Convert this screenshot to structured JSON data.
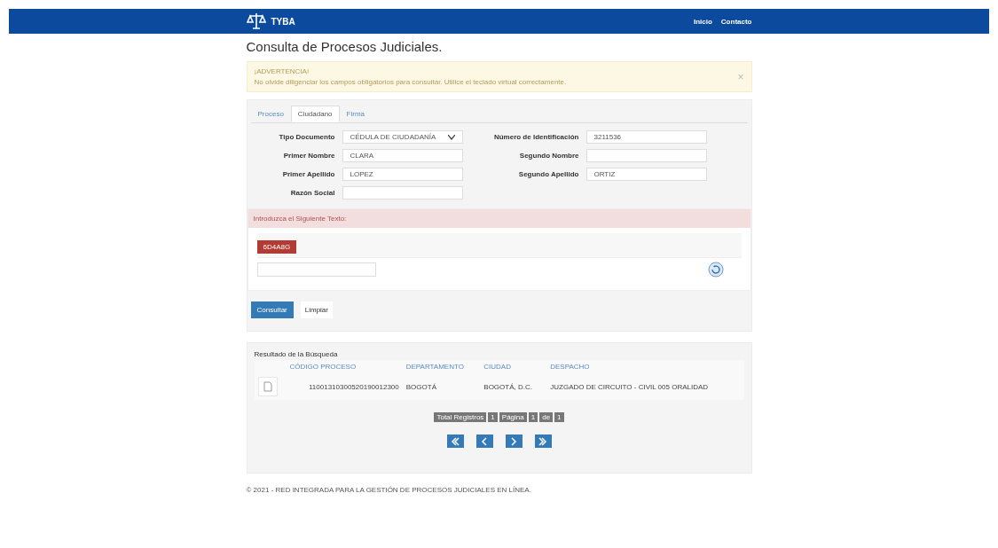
{
  "navbar": {
    "brand": "TYBA",
    "links": [
      "Inicio",
      "Contacto"
    ]
  },
  "page_title": "Consulta de Procesos Judiciales.",
  "alert": {
    "title": "¡ADVERTENCIA!",
    "message": "No olvide diligenciar los campos obligatorios para consultar. Utilice el teclado virtual correctamente.",
    "close": "×"
  },
  "tabs": [
    {
      "label": "Proceso",
      "selected": false
    },
    {
      "label": "Ciudadano",
      "selected": true
    },
    {
      "label": "Firma",
      "selected": false
    }
  ],
  "form": {
    "fields": [
      {
        "label": "Tipo Documento",
        "kind": "select",
        "value": "CÉDULA DE CIUDADANÍA"
      },
      {
        "label": "Número de Identificación",
        "kind": "text",
        "value": "3211536"
      },
      {
        "label": "Primer Nombre",
        "kind": "text",
        "value": "CLARA"
      },
      {
        "label": "Segundo Nombre",
        "kind": "text"
      },
      {
        "label": "Primer Apellido",
        "kind": "text",
        "value": "LOPEZ"
      },
      {
        "label": "Segundo Apellido",
        "kind": "text",
        "value": "ORTIZ"
      },
      {
        "label": "Razón Social",
        "kind": "text"
      }
    ]
  },
  "captcha": {
    "heading": "Introduzca el Siguiente Texto:",
    "code": "6D4A8G"
  },
  "buttons": [
    "Consultar",
    "Limpiar"
  ],
  "results": {
    "title": "Resultado de la Búsqueda",
    "columns": [
      "CÓDIGO PROCESO",
      "DEPARTAMENTO",
      "CIUDAD",
      "DESPACHO"
    ],
    "rows": [
      [
        "11001310300520190012300",
        "BOGOTÁ",
        "BOGOTÁ, D.C.",
        "JUZGADO DE CIRCUITO - CIVIL 005 ORALIDAD"
      ]
    ],
    "pager": [
      "Total Registros",
      "1",
      "Página",
      "1",
      "de",
      "1"
    ]
  },
  "footer": "© 2021 - RED INTEGRADA PARA LA GESTIÓN DE PROCESOS JUDICIALES EN LÍNEA."
}
